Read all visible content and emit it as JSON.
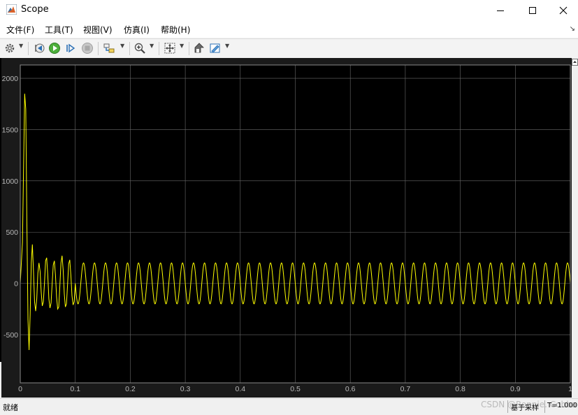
{
  "window": {
    "title": "Scope",
    "icon": "matlab-icon",
    "controls": [
      "minimize-icon",
      "maximize-icon",
      "close-icon"
    ]
  },
  "menu": {
    "items": [
      "文件(F)",
      "工具(T)",
      "视图(V)",
      "仿真(I)",
      "帮助(H)"
    ]
  },
  "toolbar": {
    "icons": [
      "gear-icon",
      "step-back-icon",
      "run-icon",
      "step-forward-icon",
      "stop-icon",
      "signal-select-icon",
      "zoom-in-icon",
      "autoscale-icon",
      "highlight-block-icon",
      "style-icon"
    ]
  },
  "status": {
    "left": "就绪",
    "mode": "基于采样",
    "time": "T=1.000",
    "watermark": "CSDN @Ronnie. Cobba"
  },
  "colors": {
    "plot_background": "#000000",
    "axes_area": "#1a1a1a",
    "grid": "#6a6a6a",
    "trace": "#ffff00",
    "tick_text": "#b8b8b8"
  },
  "chart_data": {
    "type": "line",
    "title": "",
    "xlabel": "",
    "ylabel": "",
    "xlim": [
      0,
      1
    ],
    "ylim": [
      -970,
      2130
    ],
    "grid": true,
    "legend": "none",
    "xticks": [
      0,
      0.1,
      0.2,
      0.3,
      0.4,
      0.5,
      0.6,
      0.7,
      0.8,
      0.9,
      1
    ],
    "yticks": [
      -500,
      0,
      500,
      1000,
      1500,
      2000
    ],
    "xticklabels": [
      "0",
      "0.1",
      "0.2",
      "0.3",
      "0.4",
      "0.5",
      "0.6",
      "0.7",
      "0.8",
      "0.9",
      "1"
    ],
    "yticklabels": [
      "-500",
      "0",
      "500",
      "1000",
      "1500",
      "2000"
    ],
    "series": [
      {
        "color": "#ffff00",
        "x": [
          0,
          0.004,
          0.008,
          0.01,
          0.012,
          0.014,
          0.016,
          0.018,
          0.02,
          0.022,
          0.024,
          0.026,
          0.028,
          0.03,
          0.032,
          0.034,
          0.036,
          0.038,
          0.04,
          0.042,
          0.044,
          0.046,
          0.048,
          0.05,
          0.052,
          0.054,
          0.056,
          0.058,
          0.06,
          0.062,
          0.064,
          0.066,
          0.068,
          0.07,
          0.072,
          0.074,
          0.076,
          0.078,
          0.08,
          0.082,
          0.084,
          0.086,
          0.088,
          0.09,
          0.092,
          0.094,
          0.096,
          0.098,
          0.1
        ],
        "y": [
          0,
          400,
          1850,
          1700,
          600,
          -350,
          -650,
          -300,
          200,
          380,
          120,
          -180,
          -270,
          -150,
          100,
          200,
          120,
          -80,
          -220,
          -180,
          0,
          220,
          250,
          80,
          -150,
          -240,
          -190,
          0,
          180,
          220,
          80,
          -130,
          -250,
          -230,
          -20,
          200,
          270,
          130,
          -100,
          -230,
          -200,
          -10,
          190,
          230,
          80,
          -120,
          -210,
          -180,
          0
        ]
      }
    ],
    "steady_state": {
      "amplitude": 200,
      "frequency_hz": 50,
      "x_range": [
        0.1,
        1
      ]
    }
  }
}
